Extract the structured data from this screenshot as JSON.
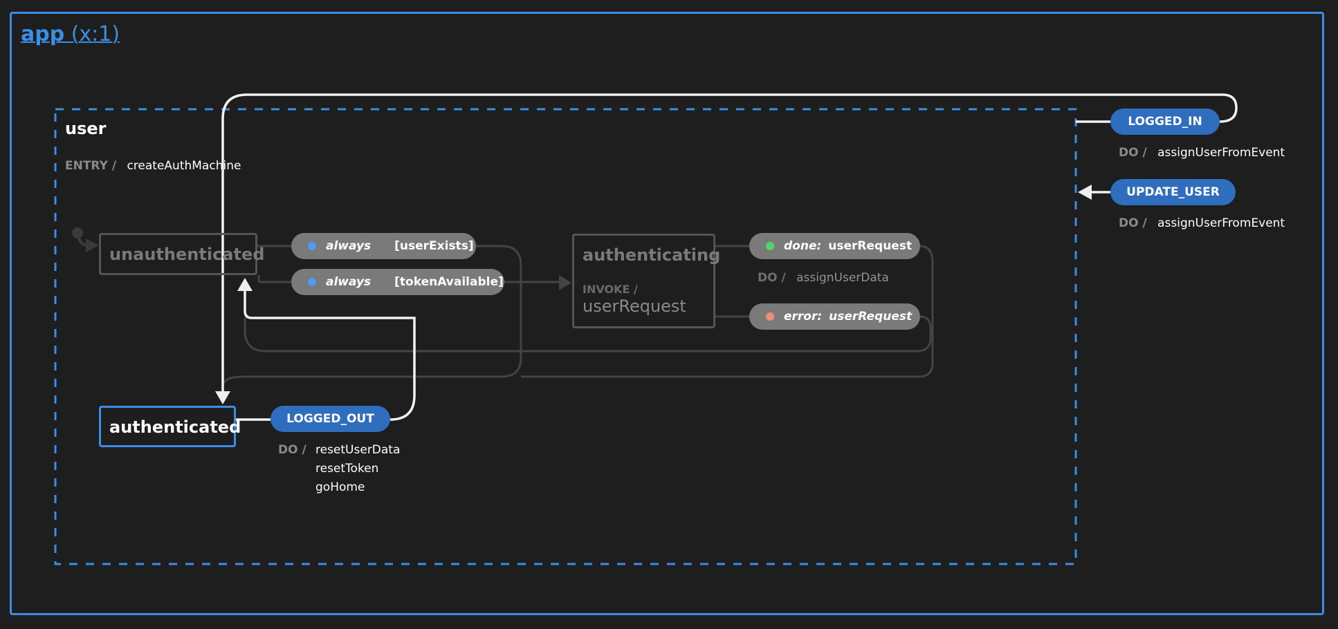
{
  "app": {
    "title_name": "app",
    "title_suffix": " (x:1)"
  },
  "user_state": {
    "title": "user",
    "entry_label": "ENTRY /",
    "entry_action": "createAuthMachine"
  },
  "states": {
    "unauthenticated": {
      "name": "unauthenticated",
      "status": "inactive"
    },
    "authenticating": {
      "name": "authenticating",
      "invoke_label": "INVOKE /",
      "invoke_src": "userRequest",
      "status": "inactive"
    },
    "authenticated": {
      "name": "authenticated",
      "status": "active"
    }
  },
  "transitions": {
    "always_user_exists": {
      "event": "always",
      "guard": "[userExists]"
    },
    "always_token": {
      "event": "always",
      "guard": "[tokenAvailable]"
    },
    "done": {
      "event": "done:",
      "target": "userRequest",
      "do_label": "DO /",
      "actions": [
        "assignUserData"
      ]
    },
    "error": {
      "event": "error:",
      "target": "userRequest"
    },
    "logged_out": {
      "event": "LOGGED_OUT",
      "do_label": "DO /",
      "actions": [
        "resetUserData",
        "resetToken",
        "goHome"
      ]
    },
    "logged_in": {
      "event": "LOGGED_IN",
      "do_label": "DO /",
      "actions": [
        "assignUserFromEvent"
      ]
    },
    "update_user": {
      "event": "UPDATE_USER",
      "do_label": "DO /",
      "actions": [
        "assignUserFromEvent"
      ]
    }
  },
  "colors": {
    "background": "#1e1e1e",
    "accent_blue": "#3a8ee6",
    "event_blue": "#2f6ebf",
    "pill_gray": "#7a7a7a",
    "always_dot": "#4a9cf5",
    "done_dot": "#4cd964",
    "error_dot": "#f28b78"
  }
}
